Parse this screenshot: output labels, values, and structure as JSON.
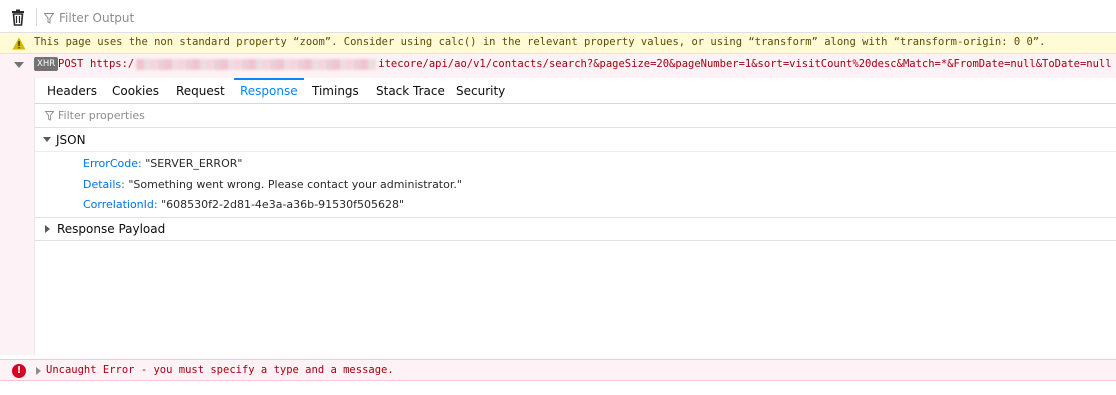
{
  "toolbar": {
    "clear_icon": "trash-icon",
    "filter_icon": "funnel-icon",
    "filter_placeholder": "Filter Output"
  },
  "warning": {
    "icon": "warning-triangle-icon",
    "text": "This page uses the non standard property “zoom”. Consider using calc() in the relevant property values, or using “transform” along with “transform-origin: 0 0”."
  },
  "request": {
    "badge": "XHR",
    "method": "POST",
    "url_prefix": "https:/",
    "url_suffix": "itecore/api/ao/v1/contacts/search?&pageSize=20&pageNumber=1&sort=visitCount%20desc&Match=*&FromDate=null&ToDate=null"
  },
  "tabs": [
    "Headers",
    "Cookies",
    "Request",
    "Response",
    "Timings",
    "Stack Trace",
    "Security"
  ],
  "active_tab": "Response",
  "filter_properties_placeholder": "Filter properties",
  "json_section": {
    "label": "JSON",
    "props": [
      {
        "key": "ErrorCode:",
        "value": "\"SERVER_ERROR\""
      },
      {
        "key": "Details:",
        "value": "\"Something went wrong. Please contact your administrator.\""
      },
      {
        "key": "CorrelationId:",
        "value": "\"608530f2-2d81-4e3a-a36b-91530f505628\""
      }
    ]
  },
  "payload_section": {
    "label": "Response Payload"
  },
  "error": {
    "icon": "error-circle-icon",
    "icon_glyph": "!",
    "text": "Uncaught Error - you must specify a type and a message."
  },
  "colors": {
    "accent": "#0a84ff",
    "error_text": "#a4000f",
    "error_bg": "#fdf2f5",
    "warning_bg": "#fffbd6",
    "warning_text": "#5f4b00",
    "prop_key": "#0074e8"
  }
}
